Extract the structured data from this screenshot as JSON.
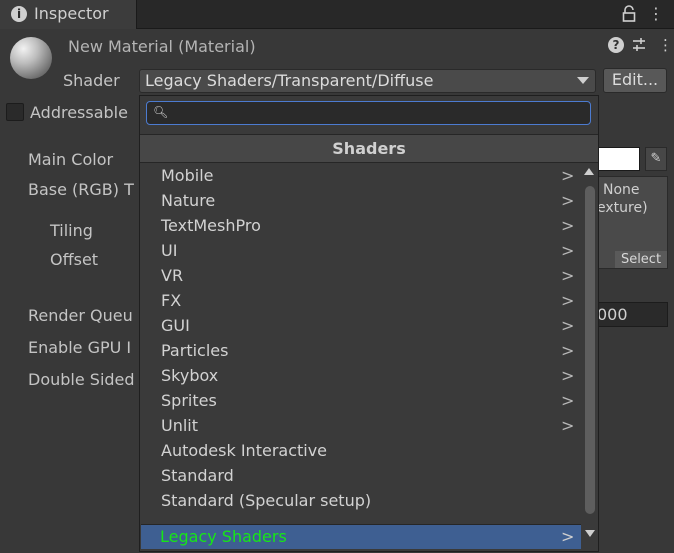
{
  "tab": {
    "title": "Inspector"
  },
  "material": {
    "title": "New Material (Material)",
    "shader_label": "Shader",
    "shader_value": "Legacy Shaders/Transparent/Diffuse",
    "edit_label": "Edit..."
  },
  "addressable": {
    "label": "Addressable",
    "checked": false
  },
  "properties": {
    "main_color": "Main Color",
    "base_rgb": "Base (RGB) T",
    "tiling": "Tiling",
    "offset": "Offset",
    "texture_none": "None",
    "texture_type": "exture)",
    "texture_select": "Select",
    "render_queue": "Render Queu",
    "render_queue_value": "000",
    "enable_gpu": "Enable GPU I",
    "double_sided": "Double Sided",
    "main_color_hex": "#ffffff"
  },
  "popup": {
    "search_placeholder": "",
    "header": "Shaders",
    "items": [
      {
        "label": "Mobile",
        "submenu": true
      },
      {
        "label": "Nature",
        "submenu": true
      },
      {
        "label": "TextMeshPro",
        "submenu": true
      },
      {
        "label": "UI",
        "submenu": true
      },
      {
        "label": "VR",
        "submenu": true
      },
      {
        "label": "FX",
        "submenu": true
      },
      {
        "label": "GUI",
        "submenu": true
      },
      {
        "label": "Particles",
        "submenu": true
      },
      {
        "label": "Skybox",
        "submenu": true
      },
      {
        "label": "Sprites",
        "submenu": true
      },
      {
        "label": "Unlit",
        "submenu": true
      },
      {
        "label": "Autodesk Interactive",
        "submenu": false
      },
      {
        "label": "Standard",
        "submenu": false
      },
      {
        "label": "Standard (Specular setup)",
        "submenu": false
      }
    ],
    "highlighted": {
      "label": "Legacy Shaders",
      "submenu": true
    }
  },
  "colors": {
    "highlight": "#3e5f92",
    "highlight_text": "#17e617",
    "search_focus": "#4c7bd0"
  }
}
